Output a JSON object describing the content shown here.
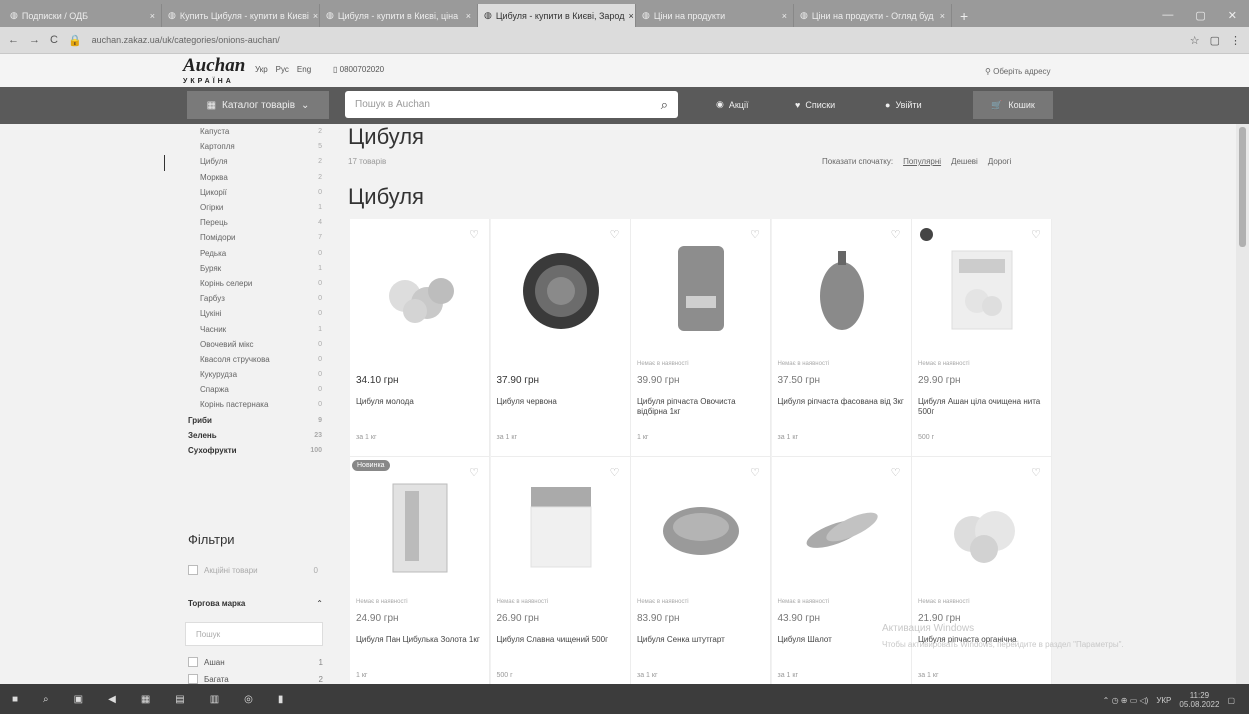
{
  "browser": {
    "tabs": [
      {
        "label": "Подписки / ОДБ",
        "active": false
      },
      {
        "label": "Купить Цибуля - купити в Києві",
        "active": false
      },
      {
        "label": "Цибуля - купити в Києві, ціна",
        "active": false
      },
      {
        "label": "Цибуля - купити в Києві, Зарод",
        "active": true
      },
      {
        "label": "Ціни на продукти",
        "active": false
      },
      {
        "label": "Ціни на продукти - Огляд буд",
        "active": false
      }
    ],
    "url": "auchan.zakaz.ua/uk/categories/onions-auchan/"
  },
  "header": {
    "logo": "Auchan",
    "logo_sub": "УКРАЇНА",
    "langs": [
      "Укр",
      "Рус",
      "Eng"
    ],
    "phone": "0800702020",
    "address": "Оберіть адресу"
  },
  "nav": {
    "catalog": "Каталог товарів",
    "search_placeholder": "Пошук в Auchan",
    "promos": "Акції",
    "lists": "Списки",
    "login": "Увійти",
    "cart": "Кошик"
  },
  "sidebar": {
    "categories": [
      {
        "label": "Капуста",
        "count": "2",
        "bold": false
      },
      {
        "label": "Картопля",
        "count": "5",
        "bold": false
      },
      {
        "label": "Цибуля",
        "count": "2",
        "bold": false
      },
      {
        "label": "Морква",
        "count": "2",
        "bold": false
      },
      {
        "label": "Цикорії",
        "count": "0",
        "bold": false
      },
      {
        "label": "Огірки",
        "count": "1",
        "bold": false
      },
      {
        "label": "Перець",
        "count": "4",
        "bold": false
      },
      {
        "label": "Помідори",
        "count": "7",
        "bold": false
      },
      {
        "label": "Редька",
        "count": "0",
        "bold": false
      },
      {
        "label": "Буряк",
        "count": "1",
        "bold": false
      },
      {
        "label": "Корінь селери",
        "count": "0",
        "bold": false
      },
      {
        "label": "Гарбуз",
        "count": "0",
        "bold": false
      },
      {
        "label": "Цукіні",
        "count": "0",
        "bold": false
      },
      {
        "label": "Часник",
        "count": "1",
        "bold": false
      },
      {
        "label": "Овочевий мікс",
        "count": "0",
        "bold": false
      },
      {
        "label": "Квасоля стручкова",
        "count": "0",
        "bold": false
      },
      {
        "label": "Кукурудза",
        "count": "0",
        "bold": false
      },
      {
        "label": "Спаржа",
        "count": "0",
        "bold": false
      },
      {
        "label": "Корінь пастернака",
        "count": "0",
        "bold": false
      },
      {
        "label": "Гриби",
        "count": "9",
        "bold": true
      },
      {
        "label": "Зелень",
        "count": "23",
        "bold": true
      },
      {
        "label": "Сухофрукти",
        "count": "100",
        "bold": true
      }
    ],
    "filters_title": "Фільтри",
    "available_label": "Акційні товари",
    "available_count": "0",
    "brand_title": "Торгова марка",
    "brand_search": "Пошук",
    "brands": [
      {
        "label": "Ашан",
        "count": "1"
      },
      {
        "label": "Багата",
        "count": "2"
      }
    ]
  },
  "main": {
    "title": "Цибуля",
    "count": "17 товарів",
    "sort_label": "Показати спочатку:",
    "sort_options": [
      "Популярні",
      "Дешеві",
      "Дорогі"
    ],
    "subtitle": "Цибуля",
    "products": [
      {
        "note": "",
        "price": "34.10 грн",
        "name": "Цибуля молода",
        "unit": "за 1 кг",
        "badge": "",
        "img": "onions-white"
      },
      {
        "note": "",
        "price": "37.90 грн",
        "name": "Цибуля червона",
        "unit": "за 1 кг",
        "badge": "",
        "img": "onion-red"
      },
      {
        "note": "Немає в наявності",
        "price": "39.90 грн",
        "name": "Цибуля ріпчаста Овочиста відбірна 1кг",
        "unit": "1 кг",
        "badge": "",
        "img": "onion-bag"
      },
      {
        "note": "Немає в наявності",
        "price": "37.50 грн",
        "name": "Цибуля ріпчаста фасована від 3кг",
        "unit": "за 1 кг",
        "badge": "",
        "img": "onion-net"
      },
      {
        "note": "Немає в наявності",
        "price": "29.90 грн",
        "name": "Цибуля Ашан ціла очищена нита 500г",
        "unit": "500 г",
        "badge": "tag",
        "img": "onion-pack"
      },
      {
        "note": "Немає в наявності",
        "price": "24.90 грн",
        "name": "Цибуля Пан Цибулька Золота 1кг",
        "unit": "1 кг",
        "badge": "Новинка",
        "img": "onion-box"
      },
      {
        "note": "Немає в наявності",
        "price": "26.90 грн",
        "name": "Цибуля Славна чищений 500г",
        "unit": "500 г",
        "badge": "",
        "img": "onion-clear"
      },
      {
        "note": "Немає в наявності",
        "price": "83.90 грн",
        "name": "Цибуля Сенка штутгарт",
        "unit": "за 1 кг",
        "badge": "",
        "img": "onion-sets"
      },
      {
        "note": "Немає в наявності",
        "price": "43.90 грн",
        "name": "Цибуля Шалот",
        "unit": "за 1 кг",
        "badge": "",
        "img": "shallot"
      },
      {
        "note": "Немає в наявності",
        "price": "21.90 грн",
        "name": "Цибуля ріпчаста органічна",
        "unit": "за 1 кг",
        "badge": "",
        "img": "onion-organic"
      }
    ]
  },
  "watermark": {
    "line1": "Активация Windows",
    "line2": "Чтобы активировать Windows, перейдите в раздел \"Параметры\"."
  },
  "taskbar": {
    "time": "11:29",
    "date": "05.08.2022",
    "lang": "УКР"
  }
}
